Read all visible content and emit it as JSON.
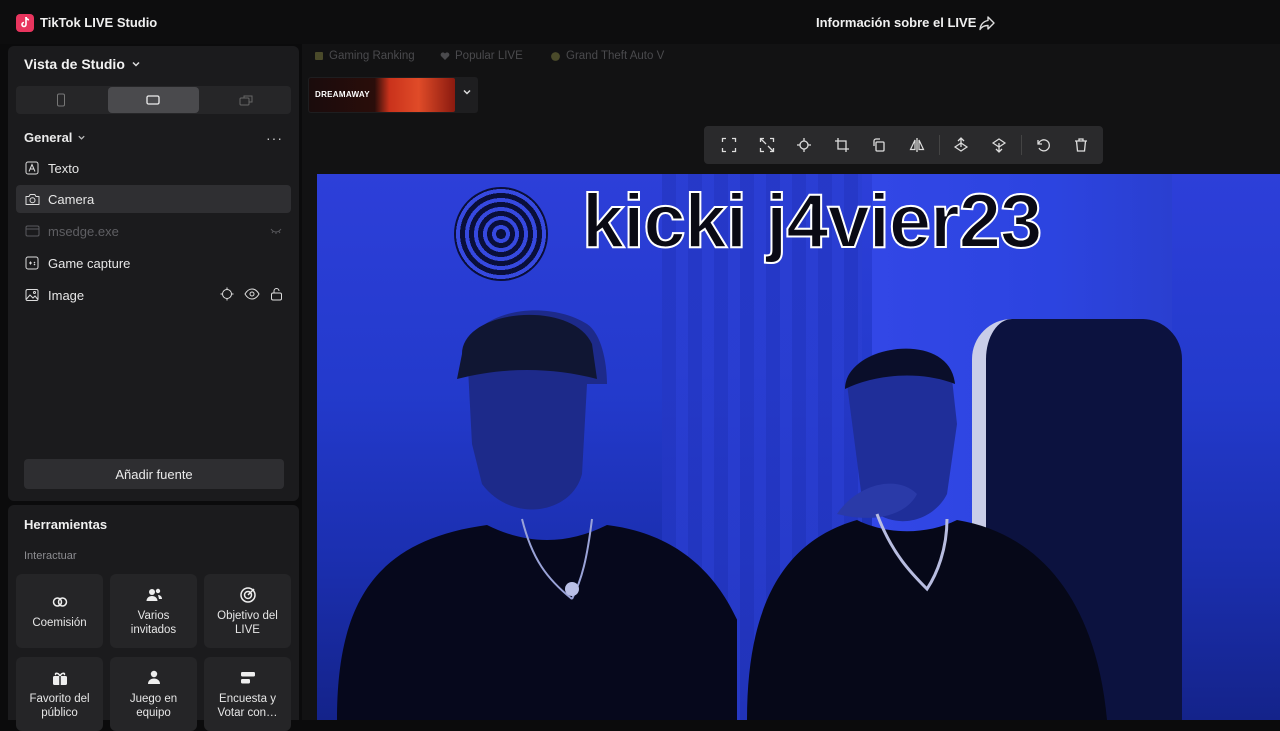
{
  "app": {
    "title": "TikTok LIVE Studio",
    "live_info": "Información sobre el LIVE"
  },
  "sidebar": {
    "view_title": "Vista de Studio",
    "scene_group": "General",
    "more": "···",
    "sources": [
      {
        "label": "Texto",
        "icon": "text-icon"
      },
      {
        "label": "Camera",
        "icon": "camera-icon"
      },
      {
        "label": "msedge.exe",
        "icon": "window-icon"
      },
      {
        "label": "Game capture",
        "icon": "gamepad-icon"
      },
      {
        "label": "Image",
        "icon": "image-icon"
      }
    ],
    "add_source": "Añadir fuente"
  },
  "tools": {
    "title": "Herramientas",
    "subtitle": "Interactuar",
    "items": [
      {
        "label": "Coemisión",
        "icon": "link-rings-icon"
      },
      {
        "label": "Varios invitados",
        "icon": "group-icon"
      },
      {
        "label": "Objetivo del LIVE",
        "icon": "target-icon"
      },
      {
        "label": "Favorito del público",
        "icon": "gift-icon"
      },
      {
        "label": "Juego en equipo",
        "icon": "team-game-icon"
      },
      {
        "label": "Encuesta y Votar con…",
        "icon": "poll-icon"
      }
    ]
  },
  "main": {
    "recommendations": [
      "Gaming Ranking",
      "Popular LIVE",
      "Grand Theft Auto V"
    ],
    "banner_text": "DREAMAWAY",
    "overlay_text": "kicki j4vier23"
  },
  "colors": {
    "accent": "#e8355e",
    "panel": "#1b1b1d",
    "stage_blue": "#2a3fd6"
  }
}
